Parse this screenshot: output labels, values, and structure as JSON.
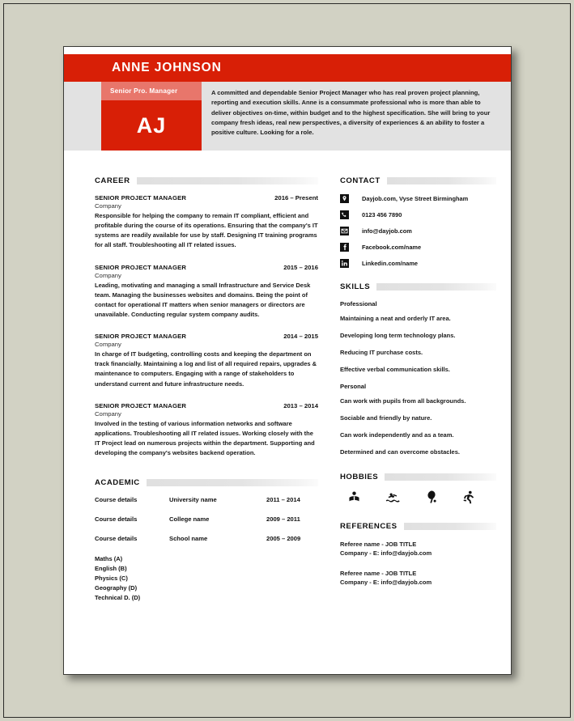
{
  "header": {
    "name": "ANNE JOHNSON",
    "role_tag": "Senior Pro. Manager",
    "initials": "AJ",
    "profile": "A committed and dependable Senior Project Manager who has real proven project planning, reporting and execution skills. Anne is a consummate professional who is more than able to deliver objectives on-time, within budget and to the highest specification. She will bring to your company fresh ideas, real new perspectives, a diversity of experiences & an ability to foster a positive culture. Looking for a role."
  },
  "colors": {
    "red": "#d81f06",
    "salmon": "#e8766b",
    "header_gray": "#e2e2e2",
    "bar_gray": "#e0e0e0",
    "page_bg": "#d2d2c4"
  },
  "career": {
    "heading": "CAREER",
    "jobs": [
      {
        "title": "SENIOR PROJECT MANAGER",
        "dates": "2016 – Present",
        "company": "Company",
        "desc": "Responsible for helping the company to remain IT compliant, efficient and profitable during the course of its operations. Ensuring that the company's IT systems are readily available for use by staff. Designing IT training programs for all staff. Troubleshooting all IT related issues."
      },
      {
        "title": "SENIOR PROJECT MANAGER",
        "dates": "2015 – 2016",
        "company": "Company",
        "desc": "Leading, motivating and managing a small Infrastructure and Service Desk team. Managing the businesses websites and domains. Being the point of contact for operational IT matters when senior managers or directors are unavailable. Conducting regular system company audits."
      },
      {
        "title": "SENIOR PROJECT MANAGER",
        "dates": "2014 – 2015",
        "company": "Company",
        "desc": "In charge of IT budgeting, controlling costs and keeping the department on track financially. Maintaining a log and list of all required repairs, upgrades & maintenance to computers. Engaging with a range of stakeholders to understand current and future infrastructure needs."
      },
      {
        "title": "SENIOR PROJECT MANAGER",
        "dates": "2013 – 2014",
        "company": "Company",
        "desc": "Involved in the testing of various information networks and software applications. Troubleshooting all IT related issues. Working closely with the IT Project lead on numerous projects within the department. Supporting and developing the company's websites backend operation."
      }
    ]
  },
  "academic": {
    "heading": "ACADEMIC",
    "rows": [
      {
        "course": "Course details",
        "institution": "University name",
        "dates": "2011 – 2014"
      },
      {
        "course": "Course details",
        "institution": "College name",
        "dates": "2009 – 2011"
      },
      {
        "course": "Course details",
        "institution": "School name",
        "dates": "2005 – 2009"
      }
    ],
    "grades": [
      "Maths (A)",
      "English (B)",
      "Physics (C)",
      "Geography (D)",
      "Technical D. (D)"
    ]
  },
  "contact": {
    "heading": "CONTACT",
    "items": [
      {
        "icon": "location-pin-icon",
        "text": "Dayjob.com, Vyse Street Birmingham"
      },
      {
        "icon": "phone-icon",
        "text": "0123 456 7890"
      },
      {
        "icon": "email-icon",
        "text": "info@dayjob.com"
      },
      {
        "icon": "facebook-icon",
        "text": "Facebook.com/name"
      },
      {
        "icon": "linkedin-icon",
        "text": "Linkedin.com/name"
      }
    ]
  },
  "skills": {
    "heading": "SKILLS",
    "professional_label": "Professional",
    "professional": [
      "Maintaining a neat and orderly IT area.",
      "Developing long term technology plans.",
      "Reducing IT purchase costs.",
      "Effective verbal communication skills."
    ],
    "personal_label": "Personal",
    "personal": [
      "Can work with pupils from all backgrounds.",
      "Sociable and friendly by nature.",
      "Can work independently and as a team.",
      "Determined and can overcome obstacles."
    ]
  },
  "hobbies": {
    "heading": "HOBBIES",
    "icons": [
      "reading-icon",
      "swimming-icon",
      "racket-sport-icon",
      "running-icon"
    ]
  },
  "references": {
    "heading": "REFERENCES",
    "items": [
      {
        "line1": "Referee name - JOB TITLE",
        "line2": "Company - E: info@dayjob.com"
      },
      {
        "line1": "Referee name - JOB TITLE",
        "line2": "Company - E: info@dayjob.com"
      }
    ]
  }
}
